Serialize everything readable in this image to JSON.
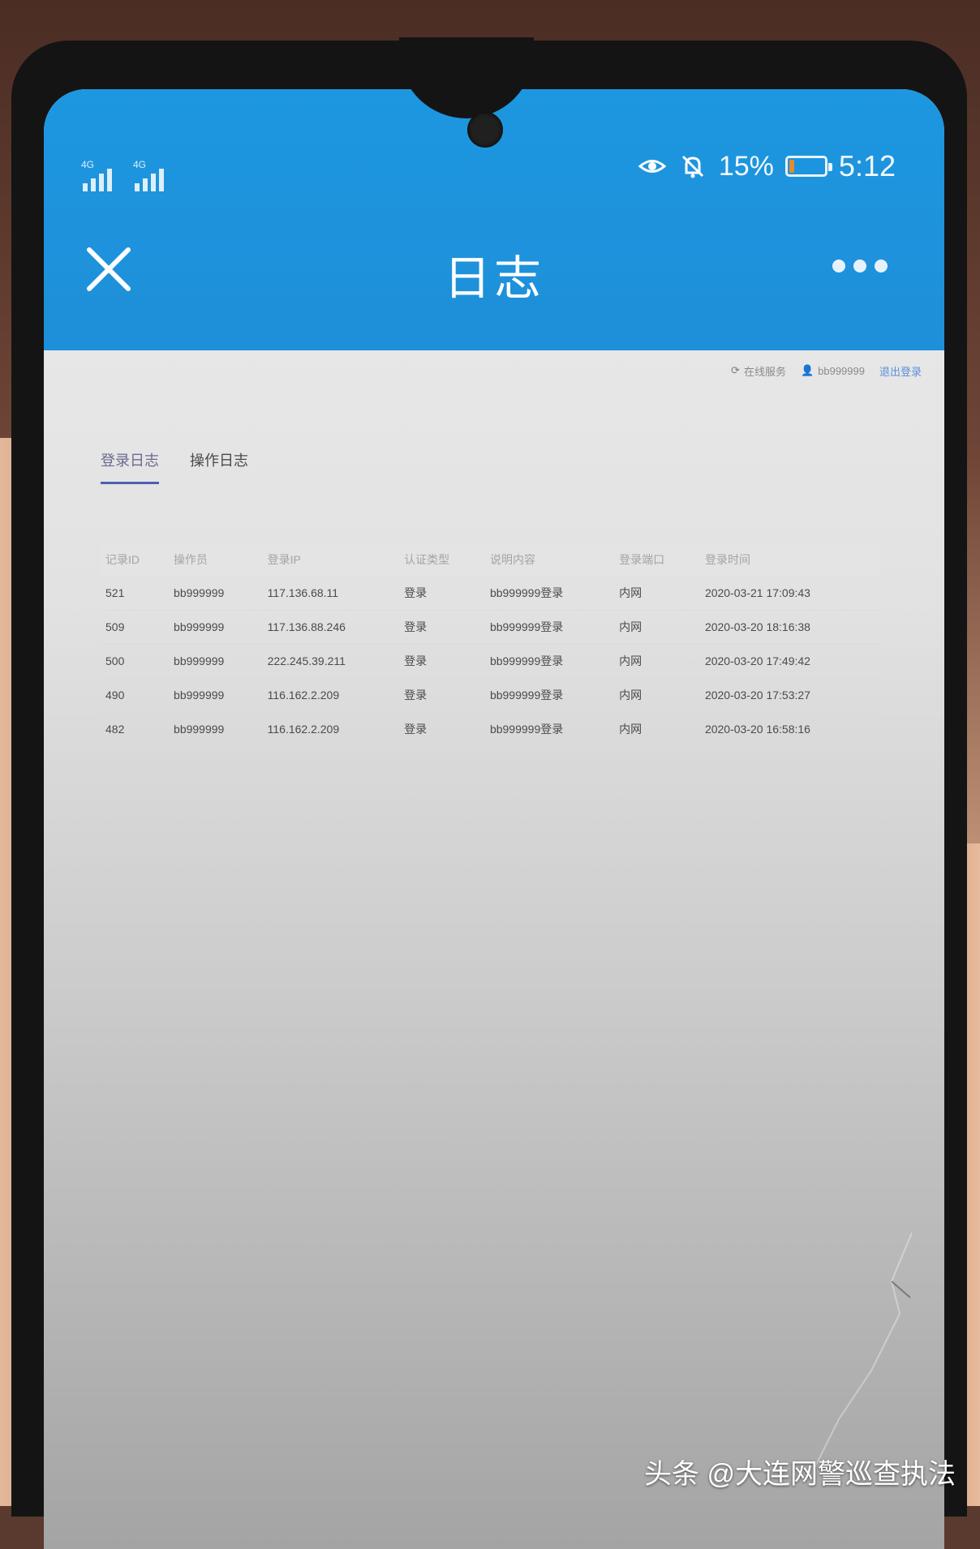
{
  "status_bar": {
    "battery_percent": "15%",
    "battery_level": 0.15,
    "battery_color": "#e58b2c",
    "time": "5:12",
    "icons": [
      "signal-icon",
      "signal-icon",
      "eye-icon",
      "bell-off-icon",
      "battery-icon"
    ]
  },
  "header": {
    "title": "日志",
    "close_icon": "close-icon",
    "more_icon": "more-dots-icon",
    "accent_color": "#1e8fd9"
  },
  "page_topbar": {
    "refresh_label": "在线服务",
    "user_label": "bb999999",
    "logout_label": "退出登录"
  },
  "tabs": [
    {
      "label": "登录日志",
      "active": true
    },
    {
      "label": "操作日志",
      "active": false
    }
  ],
  "table": {
    "columns": [
      "记录ID",
      "操作员",
      "登录IP",
      "认证类型",
      "说明内容",
      "登录端口",
      "登录时间"
    ],
    "rows": [
      [
        "521",
        "bb999999",
        "117.136.68.11",
        "登录",
        "bb999999登录",
        "内网",
        "2020-03-21 17:09:43"
      ],
      [
        "509",
        "bb999999",
        "117.136.88.246",
        "登录",
        "bb999999登录",
        "内网",
        "2020-03-20 18:16:38"
      ],
      [
        "500",
        "bb999999",
        "222.245.39.211",
        "登录",
        "bb999999登录",
        "内网",
        "2020-03-20 17:49:42"
      ],
      [
        "490",
        "bb999999",
        "116.162.2.209",
        "登录",
        "bb999999登录",
        "内网",
        "2020-03-20 17:53:27"
      ],
      [
        "482",
        "bb999999",
        "116.162.2.209",
        "登录",
        "bb999999登录",
        "内网",
        "2020-03-20 16:58:16"
      ]
    ]
  },
  "watermark": "头条 @大连网警巡查执法"
}
